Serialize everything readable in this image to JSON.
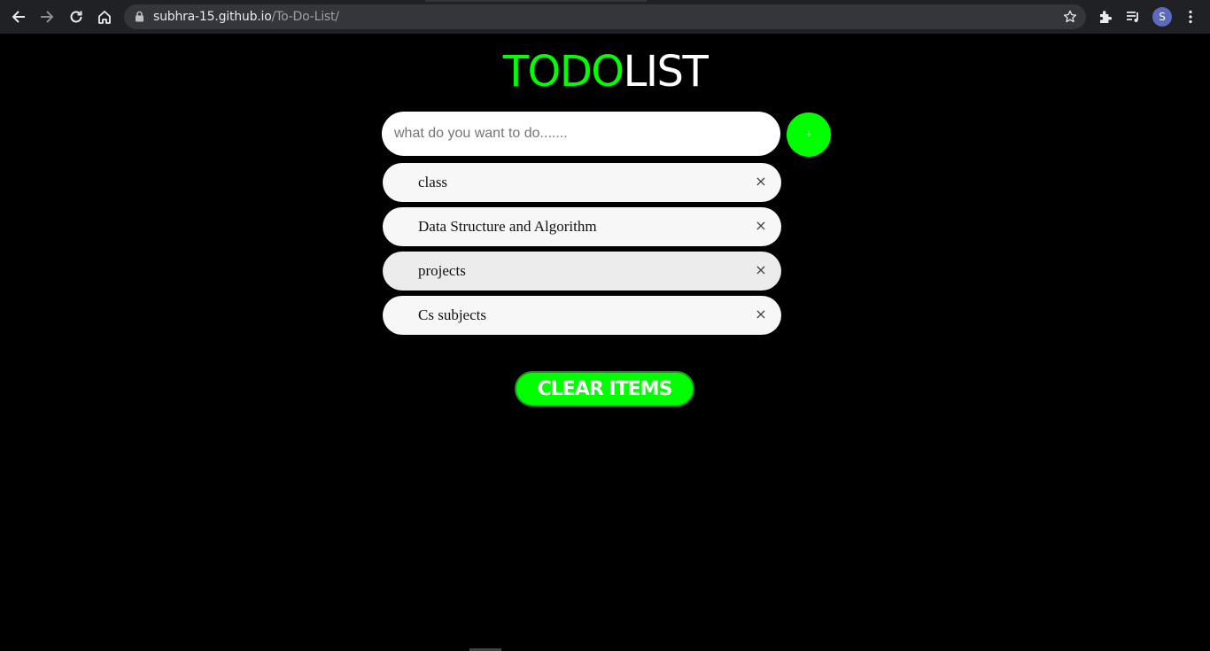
{
  "browser": {
    "url_domain": "subhra-15.github.io",
    "url_path": "/To-Do-List/",
    "profile_initial": "S"
  },
  "app": {
    "title_highlight": "TODO",
    "title_rest": "LIST",
    "input_placeholder": "what do you want to do.......",
    "add_button_label": "+",
    "clear_button_label": "CLEAR ITEMS"
  },
  "todos": [
    {
      "text": "class",
      "remove": "×"
    },
    {
      "text": "Data Structure and Algorithm",
      "remove": "×"
    },
    {
      "text": "projects",
      "remove": "×"
    },
    {
      "text": "Cs subjects",
      "remove": "×"
    }
  ],
  "colors": {
    "accent": "#00ff00",
    "background": "#000000",
    "item_bg": "#f7f7f7"
  }
}
